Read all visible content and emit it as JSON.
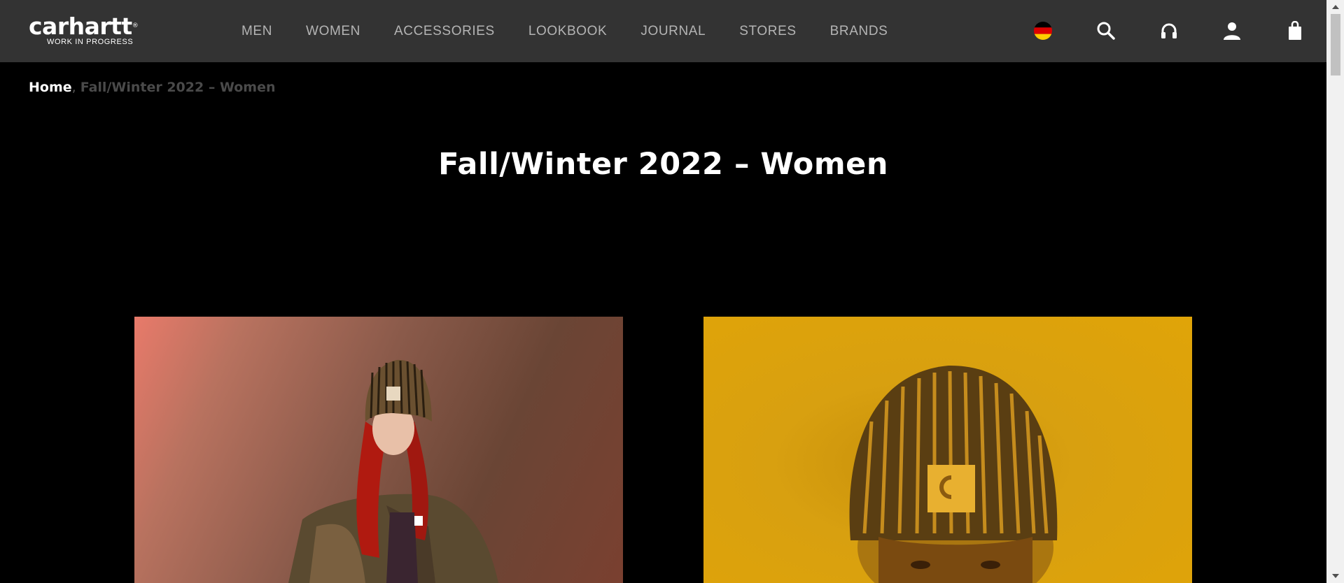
{
  "brand": {
    "name": "carhartt",
    "tagline": "WORK IN PROGRESS"
  },
  "nav": {
    "items": [
      {
        "label": "MEN"
      },
      {
        "label": "WOMEN"
      },
      {
        "label": "ACCESSORIES"
      },
      {
        "label": "LOOKBOOK"
      },
      {
        "label": "JOURNAL"
      },
      {
        "label": "STORES"
      },
      {
        "label": "BRANDS"
      }
    ]
  },
  "header_icons": [
    "germany-flag-icon",
    "search-icon",
    "headphones-icon",
    "user-icon",
    "shopping-bag-icon"
  ],
  "breadcrumb": {
    "home": "Home",
    "separator": ",",
    "current": "Fall/Winter 2022 – Women"
  },
  "page": {
    "title": "Fall/Winter 2022 – Women"
  },
  "colors": {
    "header_bg": "#333333",
    "page_bg": "#000000",
    "nav_text": "#b4b4b4",
    "breadcrumb_current": "#4a4a4a"
  },
  "images": [
    {
      "name": "lookbook-photo-red-hair-beanie"
    },
    {
      "name": "lookbook-photo-yellow-beanie"
    }
  ]
}
